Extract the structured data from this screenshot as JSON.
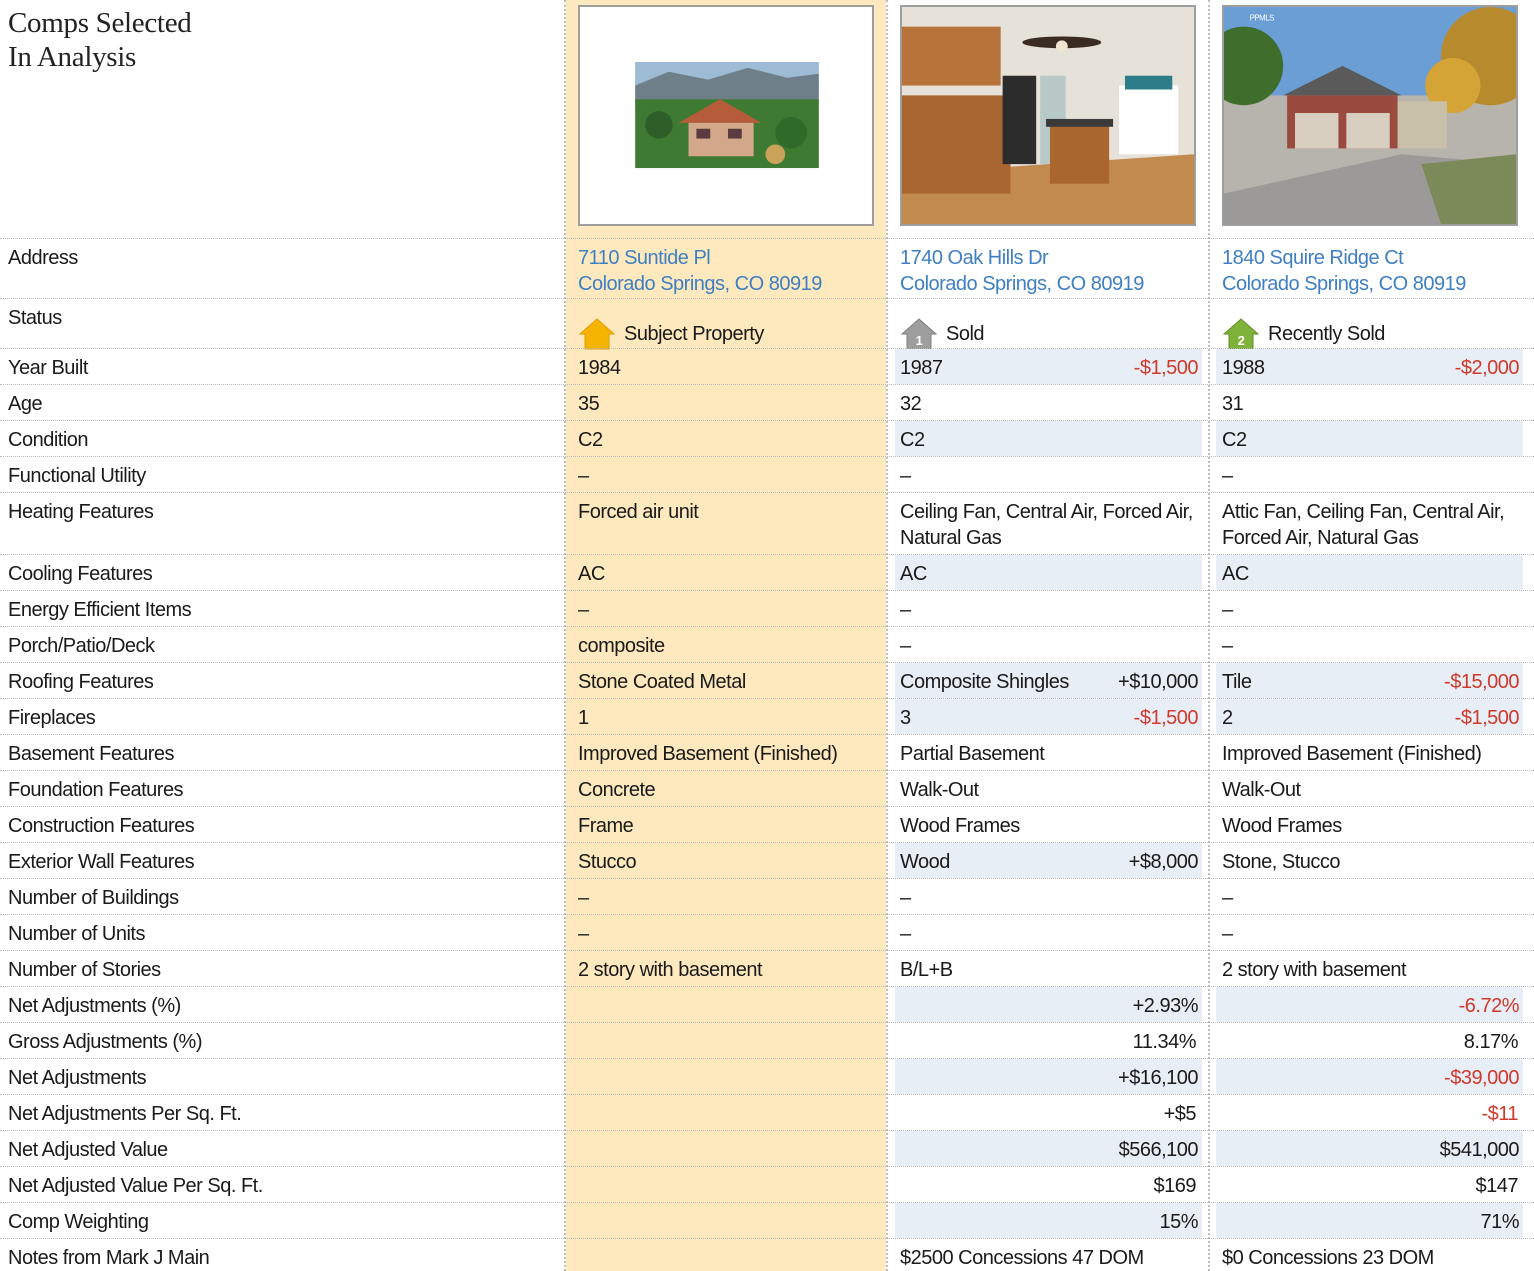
{
  "heading": {
    "line1": "Comps Selected",
    "line2": "In Analysis"
  },
  "colors": {
    "subject_bg": "#fde9bd",
    "link": "#3f7fc3",
    "negative": "#d0392b",
    "shade": "#e8eef5"
  },
  "properties": [
    {
      "address1": "7110 Suntide Pl",
      "address2": "Colorado Springs, CO 80919",
      "status": "Subject Property",
      "status_icon": "house-icon-orange"
    },
    {
      "address1": "1740 Oak Hills Dr",
      "address2": "Colorado Springs, CO 80919",
      "status": "Sold",
      "status_icon": "house-icon-gray-1",
      "badge": "1"
    },
    {
      "address1": "1840 Squire Ridge Ct",
      "address2": "Colorado Springs, CO 80919",
      "status": "Recently Sold",
      "status_icon": "house-icon-green-2",
      "badge": "2",
      "photo_mark": "PPMLS"
    }
  ],
  "labels": {
    "address": "Address",
    "status": "Status",
    "year_built": "Year Built",
    "age": "Age",
    "condition": "Condition",
    "functional_utility": "Functional Utility",
    "heating": "Heating Features",
    "cooling": "Cooling Features",
    "energy": "Energy Efficient Items",
    "porch": "Porch/Patio/Deck",
    "roofing": "Roofing Features",
    "fireplaces": "Fireplaces",
    "basement": "Basement Features",
    "foundation": "Foundation Features",
    "construction": "Construction Features",
    "exterior": "Exterior Wall Features",
    "buildings": "Number of Buildings",
    "units": "Number of Units",
    "stories": "Number of Stories",
    "net_adj_pct": "Net Adjustments (%)",
    "gross_adj_pct": "Gross Adjustments (%)",
    "net_adj": "Net Adjustments",
    "net_adj_sqft": "Net Adjustments Per Sq. Ft.",
    "net_value": "Net Adjusted Value",
    "net_value_sqft": "Net Adjusted Value Per Sq. Ft.",
    "weighting": "Comp Weighting",
    "notes": "Notes from Mark J Main"
  },
  "values": {
    "year_built": [
      "1984",
      "1987",
      "1988"
    ],
    "year_built_adj": [
      "",
      "-$1,500",
      "-$2,000"
    ],
    "age": [
      "35",
      "32",
      "31"
    ],
    "condition": [
      "C2",
      "C2",
      "C2"
    ],
    "functional_utility": [
      "–",
      "–",
      "–"
    ],
    "heating": [
      "Forced air unit",
      "Ceiling Fan, Central Air, Forced Air, Natural Gas",
      "Attic Fan, Ceiling Fan, Central Air, Forced Air, Natural Gas"
    ],
    "cooling": [
      "AC",
      "AC",
      "AC"
    ],
    "energy": [
      "–",
      "–",
      "–"
    ],
    "porch": [
      "composite",
      "–",
      "–"
    ],
    "roofing": [
      "Stone Coated Metal",
      "Composite Shingles",
      "Tile"
    ],
    "roofing_adj": [
      "",
      "+$10,000",
      "-$15,000"
    ],
    "fireplaces": [
      "1",
      "3",
      "2"
    ],
    "fireplaces_adj": [
      "",
      "-$1,500",
      "-$1,500"
    ],
    "basement": [
      "Improved Basement (Finished)",
      "Partial Basement",
      "Improved Basement (Finished)"
    ],
    "foundation": [
      "Concrete",
      "Walk-Out",
      "Walk-Out"
    ],
    "construction": [
      "Frame",
      "Wood Frames",
      "Wood Frames"
    ],
    "exterior": [
      "Stucco",
      "Wood",
      "Stone, Stucco"
    ],
    "exterior_adj": [
      "",
      "+$8,000",
      ""
    ],
    "buildings": [
      "–",
      "–",
      "–"
    ],
    "units": [
      "–",
      "–",
      "–"
    ],
    "stories": [
      "2 story with basement",
      "B/L+B",
      "2 story with basement"
    ],
    "net_adj_pct": [
      "",
      "+2.93%",
      "-6.72%"
    ],
    "gross_adj_pct": [
      "",
      "11.34%",
      "8.17%"
    ],
    "net_adj": [
      "",
      "+$16,100",
      "-$39,000"
    ],
    "net_adj_sqft": [
      "",
      "+$5",
      "-$11"
    ],
    "net_value": [
      "",
      "$566,100",
      "$541,000"
    ],
    "net_value_sqft": [
      "",
      "$169",
      "$147"
    ],
    "weighting": [
      "",
      "15%",
      "71%"
    ],
    "notes": [
      "",
      "$2500 Concessions 47 DOM",
      "$0 Concessions 23 DOM"
    ]
  }
}
